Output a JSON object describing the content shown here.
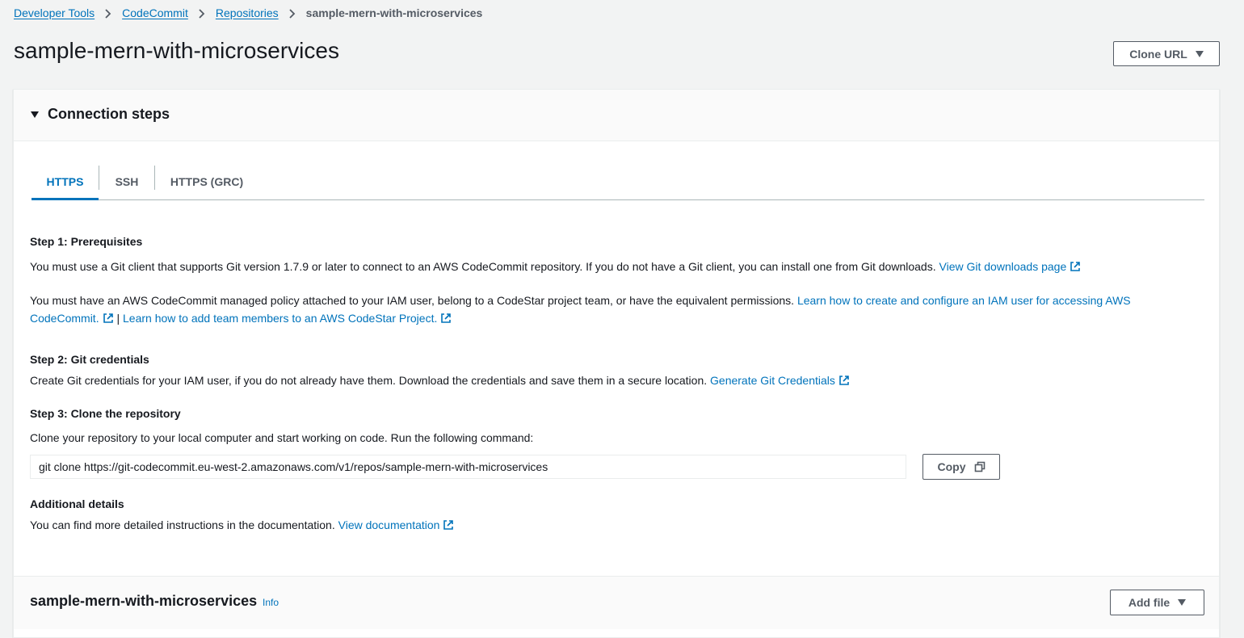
{
  "breadcrumb": {
    "items": [
      "Developer Tools",
      "CodeCommit",
      "Repositories"
    ],
    "current": "sample-mern-with-microservices"
  },
  "page": {
    "title": "sample-mern-with-microservices",
    "clone_button": "Clone URL"
  },
  "connection": {
    "title": "Connection steps",
    "tabs": [
      "HTTPS",
      "SSH",
      "HTTPS (GRC)"
    ],
    "active_tab": "HTTPS",
    "step1": {
      "heading": "Step 1: Prerequisites",
      "para1": "You must use a Git client that supports Git version 1.7.9 or later to connect to an AWS CodeCommit repository. If you do not have a Git client, you can install one from Git downloads.",
      "para1_link": "View Git downloads page",
      "para2": "You must have an AWS CodeCommit managed policy attached to your IAM user, belong to a CodeStar project team, or have the equivalent permissions.",
      "para2_link1": "Learn how to create and configure an IAM user for accessing AWS CodeCommit.",
      "para2_sep": "|",
      "para2_link2": "Learn how to add team members to an AWS CodeStar Project."
    },
    "step2": {
      "heading": "Step 2: Git credentials",
      "para": "Create Git credentials for your IAM user, if you do not already have them. Download the credentials and save them in a secure location.",
      "link": "Generate Git Credentials"
    },
    "step3": {
      "heading": "Step 3: Clone the repository",
      "para": "Clone your repository to your local computer and start working on code. Run the following command:",
      "command": "git clone https://git-codecommit.eu-west-2.amazonaws.com/v1/repos/sample-mern-with-microservices",
      "copy_button": "Copy"
    },
    "additional": {
      "heading": "Additional details",
      "para": "You can find more detailed instructions in the documentation.",
      "link": "View documentation"
    }
  },
  "repo_section": {
    "title": "sample-mern-with-microservices",
    "info": "Info",
    "add_file_button": "Add file"
  },
  "colors": {
    "link": "#0073bb",
    "text": "#16191f",
    "muted": "#545b64",
    "background": "#f2f3f3"
  }
}
